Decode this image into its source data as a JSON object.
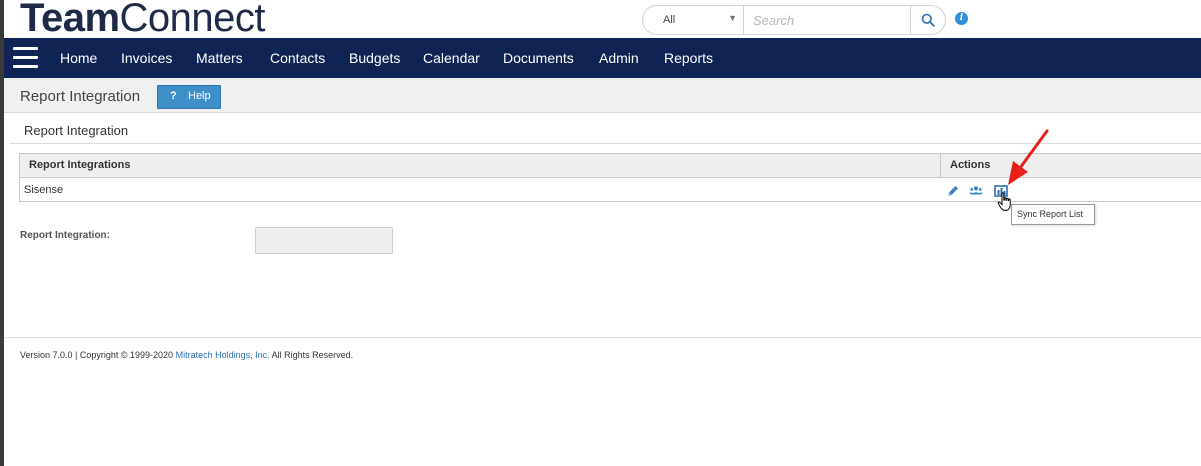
{
  "header": {
    "logo_bold": "Team",
    "logo_light": "Connect",
    "search_scope": "All",
    "search_placeholder": "Search"
  },
  "nav": {
    "items": [
      "Home",
      "Invoices",
      "Matters",
      "Contacts",
      "Budgets",
      "Calendar",
      "Documents",
      "Admin",
      "Reports"
    ]
  },
  "subheader": {
    "title": "Report Integration",
    "help_symbol": "?",
    "help_label": "Help"
  },
  "section": {
    "title": "Report Integration"
  },
  "table": {
    "columns": [
      "Report Integrations",
      "Actions"
    ],
    "rows": [
      {
        "name": "Sisense"
      }
    ]
  },
  "tooltip": {
    "text": "Sync Report List"
  },
  "form": {
    "label": "Report Integration:",
    "value": ""
  },
  "footer": {
    "text_before": "Version 7.0.0 | Copyright © 1999-2020 ",
    "link": "Mitratech Holdings, Inc.",
    "text_after": " All Rights Reserved."
  },
  "colors": {
    "nav_background": "#0f2454",
    "help_button": "#3f8fc8",
    "annotation_arrow": "#e8201a",
    "action_icons": "#3b82c4"
  },
  "icons": {
    "search": "search-icon",
    "info": "info-icon",
    "edit": "pencil-icon",
    "users": "users-icon",
    "sync": "sync-report-icon"
  }
}
